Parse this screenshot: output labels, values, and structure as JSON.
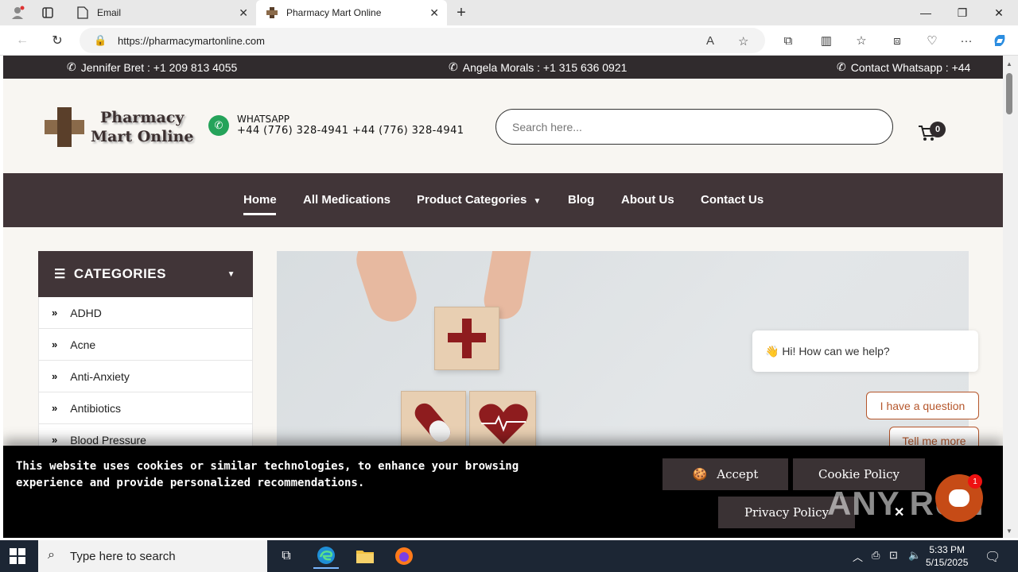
{
  "browser": {
    "tabs": [
      {
        "label": "Email"
      },
      {
        "label": "Pharmacy Mart Online"
      }
    ],
    "url": "https://pharmacymartonline.com"
  },
  "topbar": {
    "contacts": [
      "Jennifer Bret : +1 209 813 4055",
      "Angela Morals : +1 315 636 0921",
      "Contact Whatsapp : +44"
    ]
  },
  "header": {
    "logo_line1": "Pharmacy",
    "logo_line2": "Mart Online",
    "whatsapp_title": "WHATSAPP",
    "whatsapp_numbers": "+44 (776) 328-4941 +44 (776) 328-4941",
    "search_placeholder": "Search here...",
    "cart_count": "0"
  },
  "nav": {
    "items": [
      "Home",
      "All Medications",
      "Product Categories",
      "Blog",
      "About Us",
      "Contact Us"
    ]
  },
  "categories": {
    "title": "CATEGORIES",
    "items": [
      "ADHD",
      "Acne",
      "Anti-Anxiety",
      "Antibiotics",
      "Blood Pressure"
    ]
  },
  "chat": {
    "greeting": "👋 Hi! How can we help?",
    "option1": "I have a question",
    "option2": "Tell me more",
    "badge": "1"
  },
  "cookie": {
    "text": "This website uses cookies or similar technologies, to enhance your browsing experience and provide personalized recommendations.",
    "accept": "Accept",
    "policy": "Cookie Policy",
    "privacy": "Privacy Policy"
  },
  "watermark": "ANY RUN",
  "taskbar": {
    "search_placeholder": "Type here to search",
    "time": "5:33 PM",
    "date": "5/15/2025"
  }
}
